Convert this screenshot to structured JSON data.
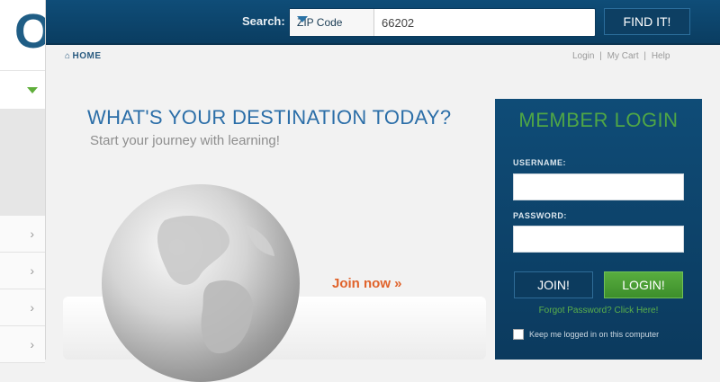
{
  "header": {
    "search_label": "Search:",
    "search_type": "ZIP Code",
    "search_value": "66202",
    "find_label": "FIND IT!"
  },
  "subnav": {
    "home_label": "HOME",
    "links": [
      "Login",
      "My Cart",
      "Help"
    ],
    "separator": "|"
  },
  "hero": {
    "title": "WHAT'S YOUR DESTINATION TODAY?",
    "subtitle": "Start your journey with learning!",
    "join_now": "Join now »"
  },
  "login": {
    "title": "MEMBER LOGIN",
    "username_label": "USERNAME:",
    "password_label": "PASSWORD:",
    "join_button": "JOIN!",
    "login_button": "LOGIN!",
    "forgot": "Forgot Password? Click Here!",
    "keep_logged": "Keep me logged in on this computer"
  },
  "colors": {
    "header_bg": "#0f4d78",
    "accent_green": "#4fa646",
    "link_orange": "#e0622a",
    "title_blue": "#2b6ea8"
  },
  "icons": {
    "search_type_arrow": "chevron-down-icon",
    "sidebar_arrow": "chevron-right-icon",
    "home": "home-icon",
    "globe": "globe-icon"
  }
}
